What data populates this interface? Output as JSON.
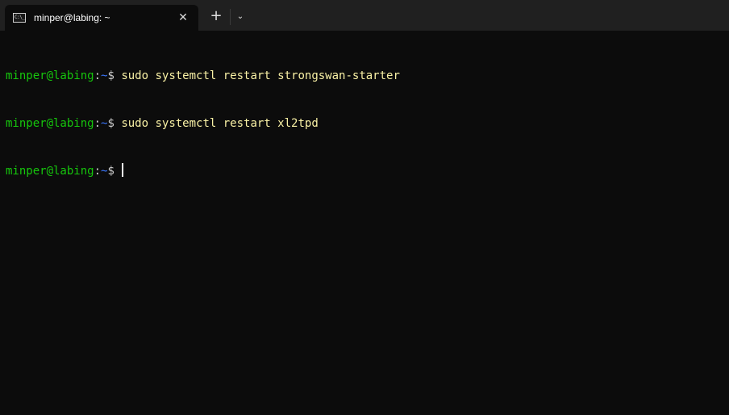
{
  "tab": {
    "title": "minper@labing: ~",
    "icon": "terminal-icon",
    "close_label": "✕"
  },
  "tabbar": {
    "new_tab_label": "+",
    "dropdown_label": "⌄"
  },
  "terminal": {
    "lines": [
      {
        "user": "minper@labing",
        "colon": ":",
        "path": "~",
        "prompt": "$ ",
        "command": "sudo systemctl restart strongswan-starter"
      },
      {
        "user": "minper@labing",
        "colon": ":",
        "path": "~",
        "prompt": "$ ",
        "command": "sudo systemctl restart xl2tpd"
      },
      {
        "user": "minper@labing",
        "colon": ":",
        "path": "~",
        "prompt": "$ ",
        "command": ""
      }
    ]
  },
  "colors": {
    "background": "#0c0c0c",
    "tabbar": "#202020",
    "user": "#16c60c",
    "path": "#3b78ff",
    "command": "#f9f1a5"
  }
}
